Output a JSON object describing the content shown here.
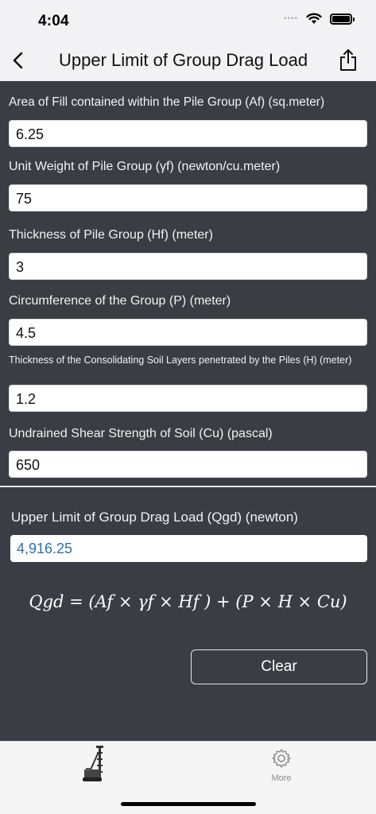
{
  "status_bar": {
    "time": "4:04"
  },
  "nav": {
    "title": "Upper Limit of Group Drag Load"
  },
  "form": {
    "fields": [
      {
        "label": "Area of Fill contained within the Pile Group (Af) (sq.meter)",
        "value": "6.25"
      },
      {
        "label": "Unit Weight of Pile Group (γf) (newton/cu.meter)",
        "value": "75"
      },
      {
        "label": "Thickness of Pile Group (Hf) (meter)",
        "value": "3"
      },
      {
        "label": "Circumference of the Group (P) (meter)",
        "value": "4.5"
      },
      {
        "label": "Thickness of the Consolidating Soil Layers penetrated by the Piles (H) (meter)",
        "value": "1.2"
      },
      {
        "label": "Undrained Shear Strength of Soil (Cu) (pascal)",
        "value": "650"
      }
    ]
  },
  "result": {
    "label": "Upper Limit of Group Drag Load (Qgd) (newton)",
    "value": "4,916.25"
  },
  "formula": "Qgd = (Af × γf × Hf ) + (P × H × Cu)",
  "buttons": {
    "clear_label": "Clear"
  },
  "tabbar": {
    "more_label": "More"
  },
  "icons": {
    "back": "chevron-left-icon",
    "share": "share-icon",
    "tab1": "drill-rig-icon",
    "tab2": "gear-icon"
  },
  "colors": {
    "background": "#3a3d44",
    "result_text": "#2a6fb6",
    "nav_background": "#f2f2f4"
  }
}
